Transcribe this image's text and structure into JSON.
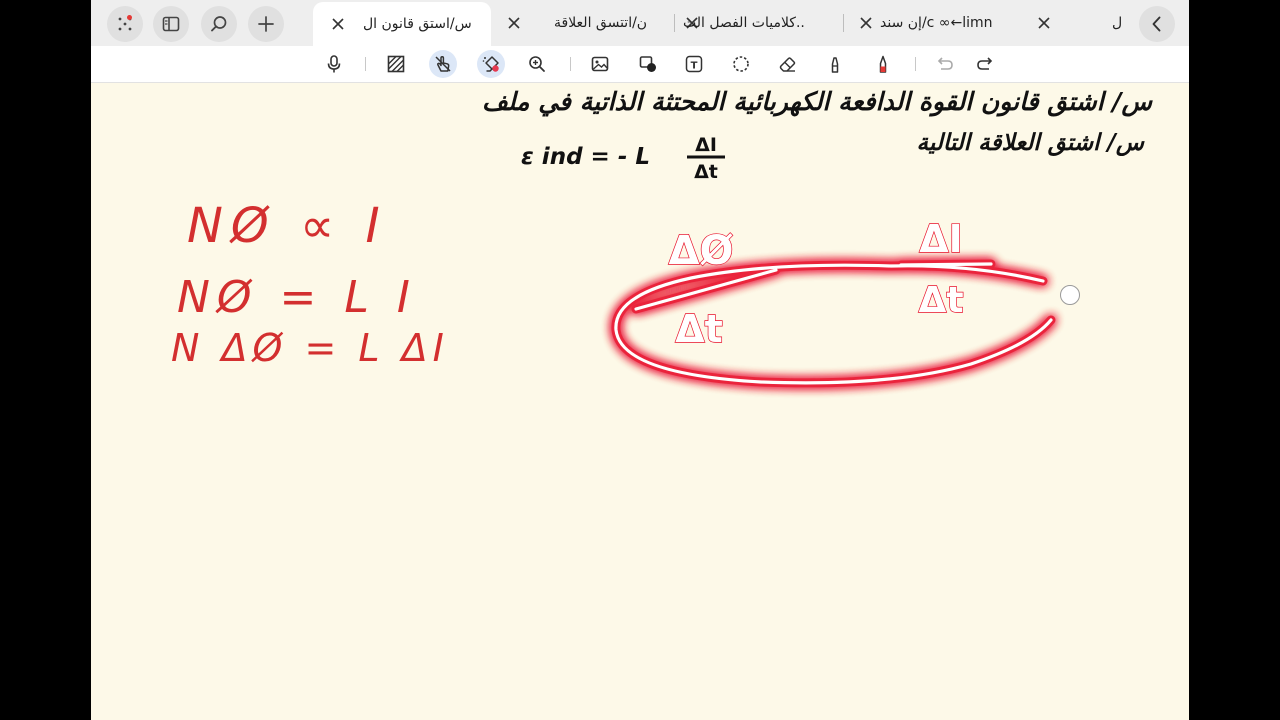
{
  "browser": {
    "tabs": [
      {
        "label": "س/استق قانون ال",
        "active": true
      },
      {
        "label": "ن/اتتسق العلاقة",
        "active": false
      },
      {
        "label": "كلاميات الفصل الث..",
        "active": false
      },
      {
        "label": "إن سند/c ∞←limn",
        "active": false
      },
      {
        "label": "ل",
        "active": false
      }
    ]
  },
  "toolbar": {
    "tools": [
      "mic-icon",
      "hatch-icon",
      "touch-draw-icon",
      "highlighter-icon",
      "zoom-icon",
      "image-icon",
      "shape-icon",
      "text-box-icon",
      "lasso-icon",
      "eraser-icon",
      "marker-icon",
      "pen-icon",
      "undo-icon",
      "redo-icon"
    ],
    "selected": [
      "touch-draw-icon",
      "highlighter-icon"
    ],
    "text_tool_letter": "T"
  },
  "canvas": {
    "question_1": "س/ اشتق قانون القوة الدافعة الكهربائية المحتثة الذاتية في ملف",
    "question_2": "س/ اشتق العلاقة التالية",
    "equation_lhs": "ε ind = - L",
    "equation_num": "ΔI",
    "equation_den": "Δt",
    "steps": [
      "NØ ∝ I",
      "NØ = L I",
      "N ΔØ = L ΔI"
    ],
    "glow_fraction_left": {
      "num": "ΔØ",
      "den": "Δt"
    },
    "glow_fraction_right": {
      "num": "ΔI",
      "den": "Δt"
    },
    "ink_color": "#d32f2f",
    "glow_color": "#e8102a"
  }
}
